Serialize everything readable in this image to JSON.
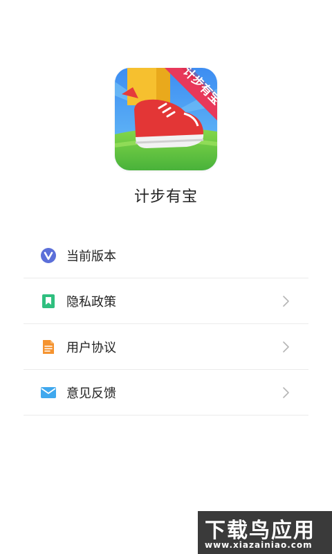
{
  "app": {
    "name": "计步有宝",
    "icon_ribbon_text": "计步有宝"
  },
  "menu": {
    "items": [
      {
        "label": "当前版本",
        "icon": "version-v-icon",
        "has_chevron": false
      },
      {
        "label": "隐私政策",
        "icon": "bookmark-icon",
        "has_chevron": true
      },
      {
        "label": "用户协议",
        "icon": "document-icon",
        "has_chevron": true
      },
      {
        "label": "意见反馈",
        "icon": "mail-icon",
        "has_chevron": true
      }
    ]
  },
  "watermark": {
    "title": "下载鸟应用",
    "url": "www.xiazainiao.com"
  },
  "colors": {
    "version_icon": "#5b6fd9",
    "privacy_icon": "#2fbf7f",
    "agreement_icon": "#f5932f",
    "feedback_icon": "#3fa8ee",
    "chevron": "#b5b5b5",
    "divider": "#ebebeb"
  }
}
